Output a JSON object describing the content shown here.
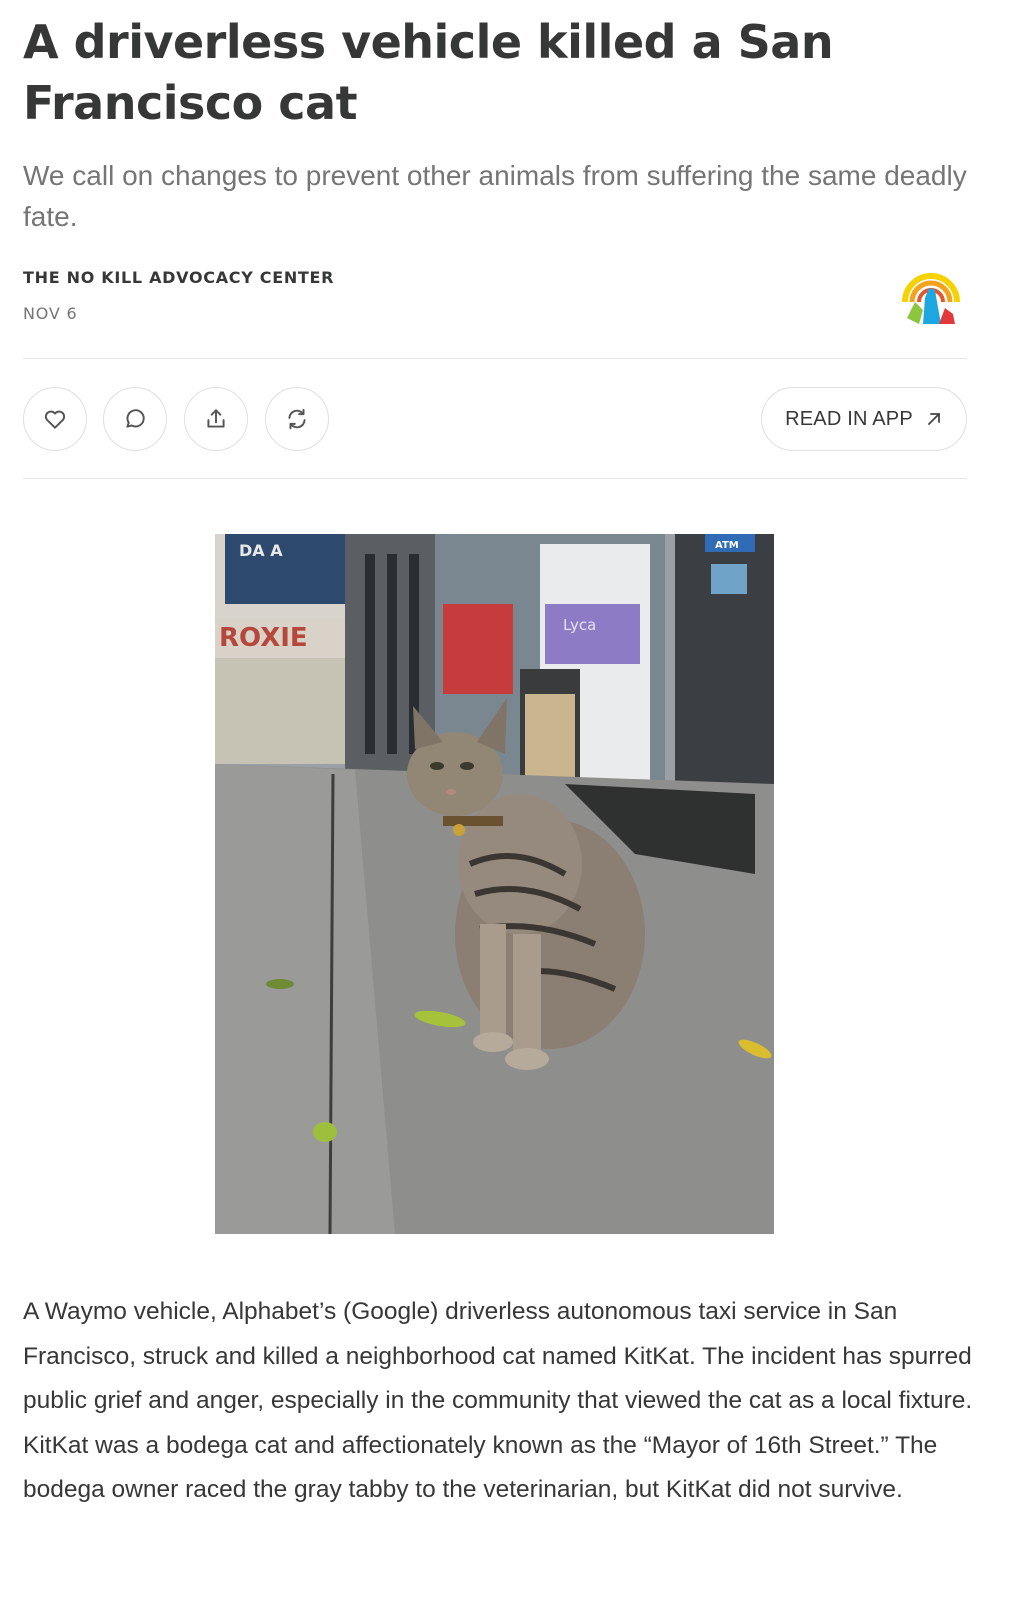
{
  "article": {
    "title": "A driverless vehicle killed a San Francisco cat",
    "subtitle": "We call on changes to prevent other animals from suffering the same deadly fate.",
    "author": "THE NO KILL ADVOCACY CENTER",
    "date": "NOV 6",
    "body": "A Waymo vehicle, Alphabet’s (Google) driverless autonomous taxi service in San Francisco, struck and killed a neighborhood cat named KitKat. The incident has spurred public grief and anger, especially in the community that viewed the cat as a local fixture. KitKat was a bodega cat and affectionately known as the “Mayor of 16th Street.” The bodega owner raced the gray tabby to the veterinarian, but KitKat did not survive."
  },
  "actions": {
    "like_icon": "heart-icon",
    "comment_icon": "comment-icon",
    "share_icon": "share-icon",
    "restack_icon": "restack-icon",
    "read_in_app_label": "READ IN APP",
    "read_in_app_icon": "arrow-up-right-icon"
  },
  "photo": {
    "storefront_sign": "ROXIE",
    "atm_sign": "ATM",
    "poster_text": "Lyca"
  },
  "colors": {
    "text": "#363737",
    "muted": "#757575",
    "divider": "#e6e6e6"
  }
}
